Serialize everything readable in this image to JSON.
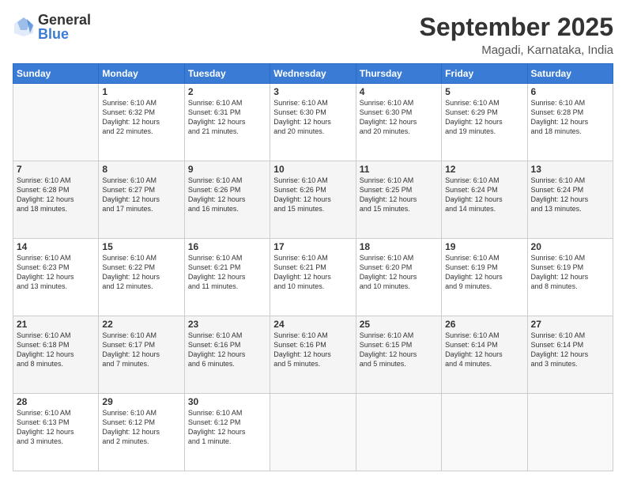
{
  "logo": {
    "general": "General",
    "blue": "Blue"
  },
  "header": {
    "month": "September 2025",
    "location": "Magadi, Karnataka, India"
  },
  "days_of_week": [
    "Sunday",
    "Monday",
    "Tuesday",
    "Wednesday",
    "Thursday",
    "Friday",
    "Saturday"
  ],
  "weeks": [
    [
      {
        "day": "",
        "info": ""
      },
      {
        "day": "1",
        "info": "Sunrise: 6:10 AM\nSunset: 6:32 PM\nDaylight: 12 hours\nand 22 minutes."
      },
      {
        "day": "2",
        "info": "Sunrise: 6:10 AM\nSunset: 6:31 PM\nDaylight: 12 hours\nand 21 minutes."
      },
      {
        "day": "3",
        "info": "Sunrise: 6:10 AM\nSunset: 6:30 PM\nDaylight: 12 hours\nand 20 minutes."
      },
      {
        "day": "4",
        "info": "Sunrise: 6:10 AM\nSunset: 6:30 PM\nDaylight: 12 hours\nand 20 minutes."
      },
      {
        "day": "5",
        "info": "Sunrise: 6:10 AM\nSunset: 6:29 PM\nDaylight: 12 hours\nand 19 minutes."
      },
      {
        "day": "6",
        "info": "Sunrise: 6:10 AM\nSunset: 6:28 PM\nDaylight: 12 hours\nand 18 minutes."
      }
    ],
    [
      {
        "day": "7",
        "info": "Sunrise: 6:10 AM\nSunset: 6:28 PM\nDaylight: 12 hours\nand 18 minutes."
      },
      {
        "day": "8",
        "info": "Sunrise: 6:10 AM\nSunset: 6:27 PM\nDaylight: 12 hours\nand 17 minutes."
      },
      {
        "day": "9",
        "info": "Sunrise: 6:10 AM\nSunset: 6:26 PM\nDaylight: 12 hours\nand 16 minutes."
      },
      {
        "day": "10",
        "info": "Sunrise: 6:10 AM\nSunset: 6:26 PM\nDaylight: 12 hours\nand 15 minutes."
      },
      {
        "day": "11",
        "info": "Sunrise: 6:10 AM\nSunset: 6:25 PM\nDaylight: 12 hours\nand 15 minutes."
      },
      {
        "day": "12",
        "info": "Sunrise: 6:10 AM\nSunset: 6:24 PM\nDaylight: 12 hours\nand 14 minutes."
      },
      {
        "day": "13",
        "info": "Sunrise: 6:10 AM\nSunset: 6:24 PM\nDaylight: 12 hours\nand 13 minutes."
      }
    ],
    [
      {
        "day": "14",
        "info": "Sunrise: 6:10 AM\nSunset: 6:23 PM\nDaylight: 12 hours\nand 13 minutes."
      },
      {
        "day": "15",
        "info": "Sunrise: 6:10 AM\nSunset: 6:22 PM\nDaylight: 12 hours\nand 12 minutes."
      },
      {
        "day": "16",
        "info": "Sunrise: 6:10 AM\nSunset: 6:21 PM\nDaylight: 12 hours\nand 11 minutes."
      },
      {
        "day": "17",
        "info": "Sunrise: 6:10 AM\nSunset: 6:21 PM\nDaylight: 12 hours\nand 10 minutes."
      },
      {
        "day": "18",
        "info": "Sunrise: 6:10 AM\nSunset: 6:20 PM\nDaylight: 12 hours\nand 10 minutes."
      },
      {
        "day": "19",
        "info": "Sunrise: 6:10 AM\nSunset: 6:19 PM\nDaylight: 12 hours\nand 9 minutes."
      },
      {
        "day": "20",
        "info": "Sunrise: 6:10 AM\nSunset: 6:19 PM\nDaylight: 12 hours\nand 8 minutes."
      }
    ],
    [
      {
        "day": "21",
        "info": "Sunrise: 6:10 AM\nSunset: 6:18 PM\nDaylight: 12 hours\nand 8 minutes."
      },
      {
        "day": "22",
        "info": "Sunrise: 6:10 AM\nSunset: 6:17 PM\nDaylight: 12 hours\nand 7 minutes."
      },
      {
        "day": "23",
        "info": "Sunrise: 6:10 AM\nSunset: 6:16 PM\nDaylight: 12 hours\nand 6 minutes."
      },
      {
        "day": "24",
        "info": "Sunrise: 6:10 AM\nSunset: 6:16 PM\nDaylight: 12 hours\nand 5 minutes."
      },
      {
        "day": "25",
        "info": "Sunrise: 6:10 AM\nSunset: 6:15 PM\nDaylight: 12 hours\nand 5 minutes."
      },
      {
        "day": "26",
        "info": "Sunrise: 6:10 AM\nSunset: 6:14 PM\nDaylight: 12 hours\nand 4 minutes."
      },
      {
        "day": "27",
        "info": "Sunrise: 6:10 AM\nSunset: 6:14 PM\nDaylight: 12 hours\nand 3 minutes."
      }
    ],
    [
      {
        "day": "28",
        "info": "Sunrise: 6:10 AM\nSunset: 6:13 PM\nDaylight: 12 hours\nand 3 minutes."
      },
      {
        "day": "29",
        "info": "Sunrise: 6:10 AM\nSunset: 6:12 PM\nDaylight: 12 hours\nand 2 minutes."
      },
      {
        "day": "30",
        "info": "Sunrise: 6:10 AM\nSunset: 6:12 PM\nDaylight: 12 hours\nand 1 minute."
      },
      {
        "day": "",
        "info": ""
      },
      {
        "day": "",
        "info": ""
      },
      {
        "day": "",
        "info": ""
      },
      {
        "day": "",
        "info": ""
      }
    ]
  ]
}
